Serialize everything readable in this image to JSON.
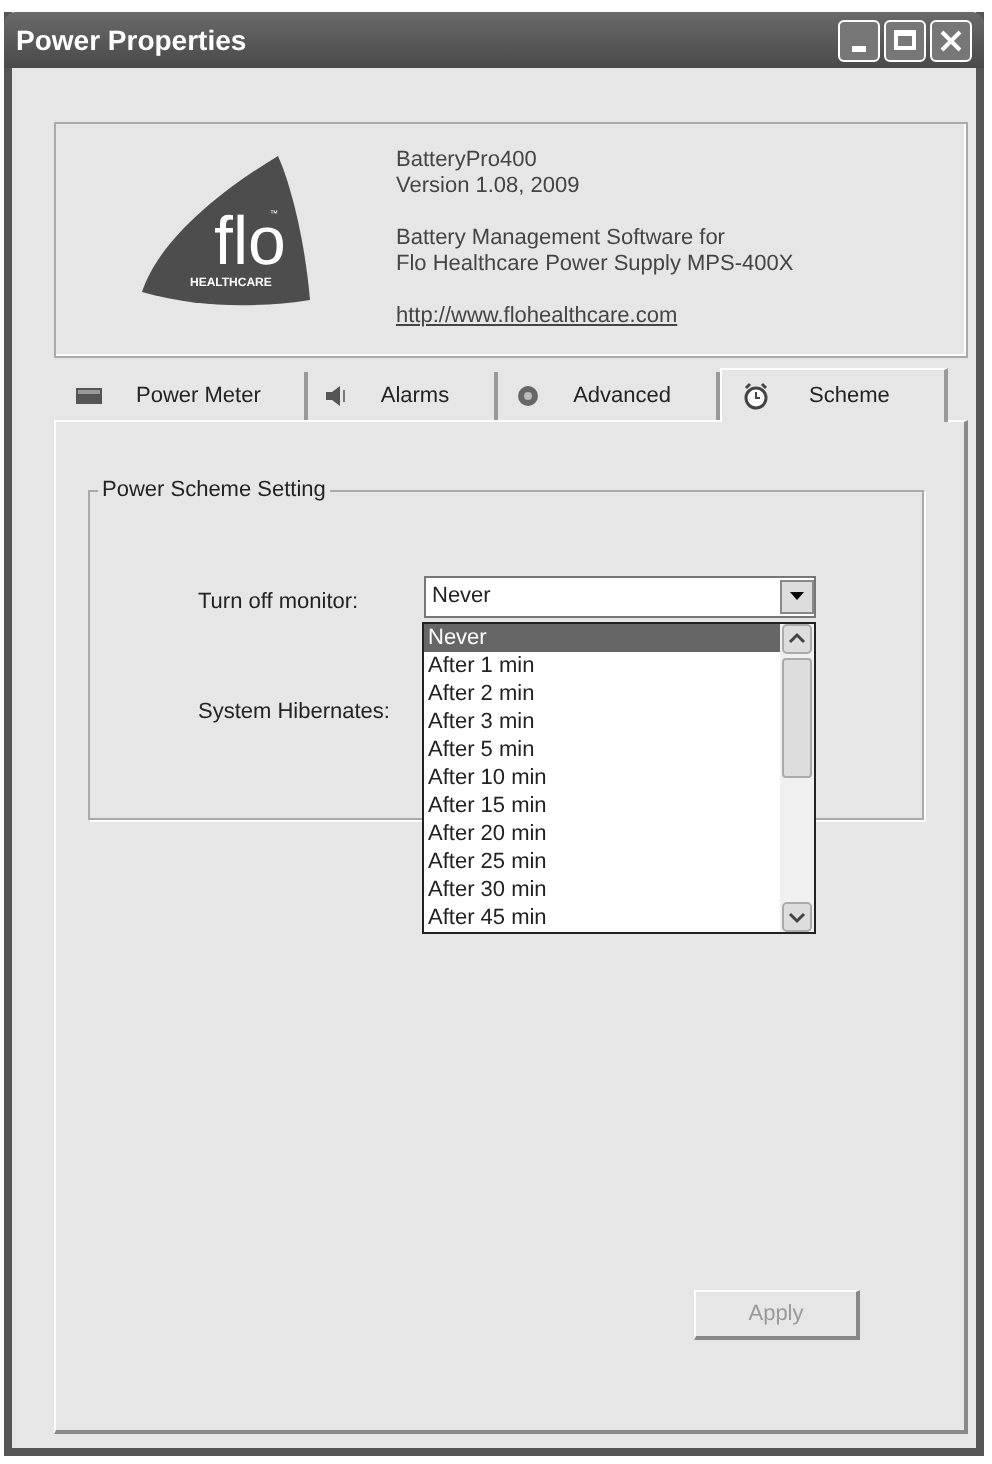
{
  "window": {
    "title": "Power Properties"
  },
  "about": {
    "logo_text": "flo",
    "logo_subtext": "HEALTHCARE",
    "logo_mark": "™",
    "product": "BatteryPro400",
    "version": "Version  1.08, 2009",
    "description": [
      "Battery Management Software for",
      "Flo Healthcare Power Supply MPS-400X"
    ],
    "link": "http://www.flohealthcare.com"
  },
  "tabs": [
    {
      "label": "Power Meter",
      "kind": "battery",
      "selected": false
    },
    {
      "label": "Alarms",
      "kind": "speaker",
      "selected": false
    },
    {
      "label": "Advanced",
      "kind": "gear",
      "selected": false
    },
    {
      "label": "Scheme",
      "kind": "clock",
      "selected": true
    }
  ],
  "group": {
    "title": "Power Scheme Setting",
    "fields": [
      {
        "label": "Turn off monitor:",
        "value": "Never"
      },
      {
        "label": "System Hibernates:"
      }
    ],
    "dropdown_options": [
      {
        "label": "Never",
        "selected": true
      },
      {
        "label": "After 1 min",
        "selected": false
      },
      {
        "label": "After 2 min",
        "selected": false
      },
      {
        "label": "After 3 min",
        "selected": false
      },
      {
        "label": "After 5 min",
        "selected": false
      },
      {
        "label": "After 10 min",
        "selected": false
      },
      {
        "label": "After 15 min",
        "selected": false
      },
      {
        "label": "After 20 min",
        "selected": false
      },
      {
        "label": "After 25 min",
        "selected": false
      },
      {
        "label": "After 30 min",
        "selected": false
      },
      {
        "label": "After 45 min",
        "selected": false
      }
    ]
  },
  "apply_button": {
    "label": "Apply",
    "disabled": true
  }
}
